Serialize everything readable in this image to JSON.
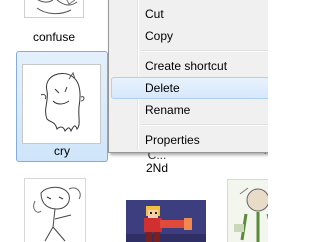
{
  "files": [
    {
      "name": "confuse"
    },
    {
      "name": "cry",
      "selected": true
    },
    {
      "name_line1": "C...",
      "name_line2": "2Nd"
    },
    {
      "name": ""
    },
    {
      "name": ""
    },
    {
      "name": ""
    }
  ],
  "edge_text": "(",
  "context_menu": {
    "items": [
      {
        "label": "Cut"
      },
      {
        "label": "Copy"
      },
      {
        "label": "Create shortcut"
      },
      {
        "label": "Delete",
        "highlighted": true
      },
      {
        "label": "Rename"
      },
      {
        "label": "Properties"
      }
    ]
  },
  "colors": {
    "selection_fill": "#cfe5fa",
    "selection_border": "#84acdd",
    "menu_background": "#f0f0f0",
    "menu_highlight": "#d7e8fb",
    "menu_highlight_border": "#aecff7",
    "game_background": "#3d3e7f"
  }
}
